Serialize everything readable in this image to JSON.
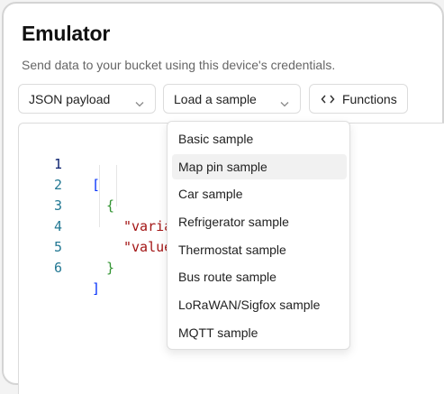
{
  "header": {
    "title": "Emulator",
    "subtitle": "Send data to your bucket using this device's credentials."
  },
  "toolbar": {
    "payload_select": "JSON payload",
    "sample_select": "Load a sample",
    "functions_label": "Functions"
  },
  "editor": {
    "line_numbers": [
      "1",
      "2",
      "3",
      "4",
      "5",
      "6"
    ],
    "active_line": "1",
    "lines": {
      "l1": "[",
      "l2": "{",
      "l3": "\"varia",
      "l4": "\"value",
      "l5": "}",
      "l6": "]"
    }
  },
  "sample_menu": {
    "items": [
      "Basic sample",
      "Map pin sample",
      "Car sample",
      "Refrigerator sample",
      "Thermostat sample",
      "Bus route sample",
      "LoRaWAN/Sigfox sample",
      "MQTT sample"
    ],
    "highlighted": "Map pin sample"
  },
  "icons": {
    "payload_chevron": "chevron-down-icon",
    "sample_chevron": "chevron-down-icon",
    "functions_icon": "code-icon"
  },
  "colors": {
    "bracket_blue": "#0431fa",
    "bracket_green": "#319331",
    "string_red": "#a31515",
    "line_number": "#237893"
  }
}
